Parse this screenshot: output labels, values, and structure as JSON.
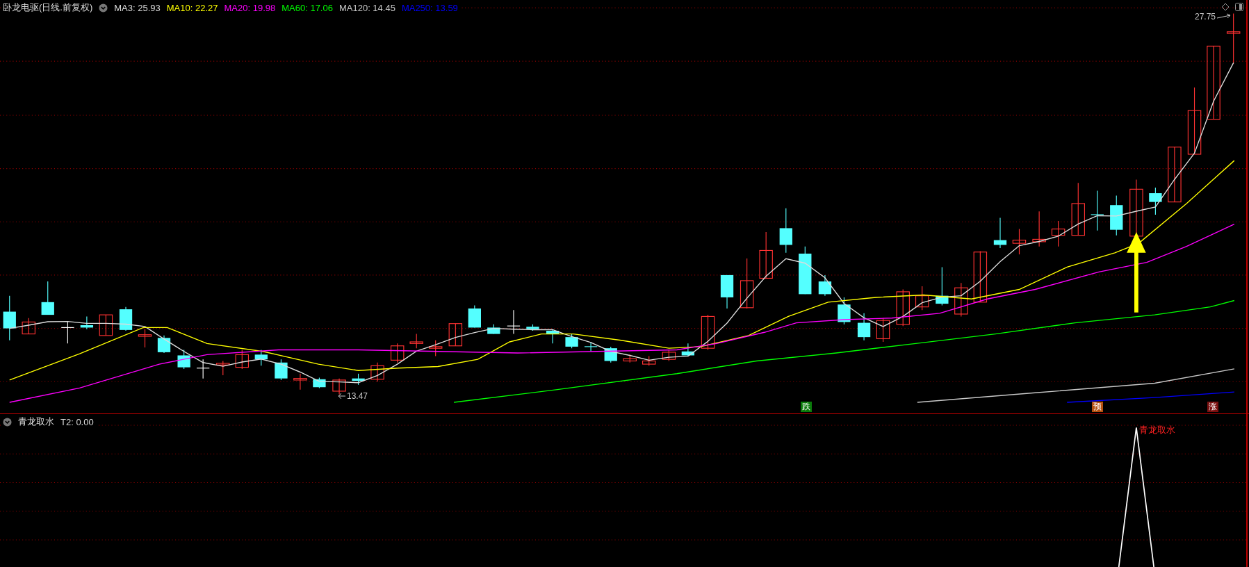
{
  "stock_header": {
    "title": "卧龙电驱(日线.前复权)"
  },
  "moving_averages": [
    {
      "label": "MA3: 25.93",
      "color": "#dcdcdc"
    },
    {
      "label": "MA10: 22.27",
      "color": "#ffff00"
    },
    {
      "label": "MA20: 19.98",
      "color": "#ff00ff"
    },
    {
      "label": "MA60: 17.06",
      "color": "#00ff00"
    },
    {
      "label": "MA120: 14.45",
      "color": "#c8c8c8"
    },
    {
      "label": "MA250: 13.59",
      "color": "#0000ff"
    }
  ],
  "price_labels": {
    "high": "27.75",
    "low": "13.47"
  },
  "signals": [
    {
      "label": "跌",
      "color": "#0a7a0a"
    },
    {
      "label": "预",
      "color": "#b5500f"
    },
    {
      "label": "涨",
      "color": "#7a1010"
    }
  ],
  "indicator": {
    "title": "青龙取水",
    "reading": "T2: 0.00",
    "signal_label": "青龙取水"
  }
}
